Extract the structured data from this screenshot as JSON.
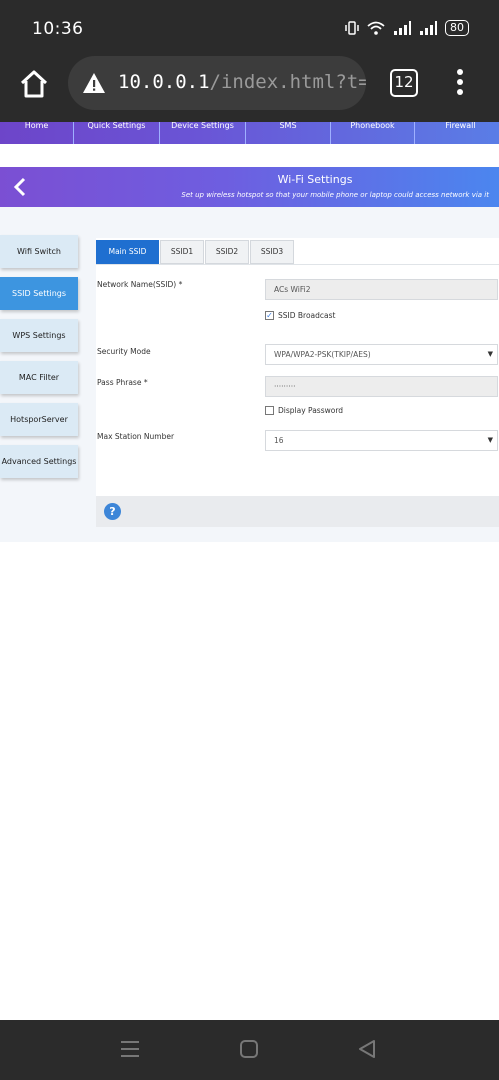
{
  "status": {
    "time": "10:36",
    "battery": "80"
  },
  "browser": {
    "url_host": "10.0.0.1",
    "url_path": "/index.html?t=#wifi",
    "tab_count": "12"
  },
  "top_nav": [
    {
      "label": "Home",
      "w": 66
    },
    {
      "label": "Quick Settings",
      "w": 86
    },
    {
      "label": "Device Settings",
      "w": 86
    },
    {
      "label": "SMS",
      "w": 85
    },
    {
      "label": "Phonebook",
      "w": 84
    },
    {
      "label": "Firewall",
      "w": 92
    }
  ],
  "header": {
    "title": "Wi-Fi Settings",
    "subtitle": "Set up wireless hotspot so that your mobile phone or laptop could access network via it"
  },
  "sidebar": {
    "items": [
      {
        "label": "Wifi Switch"
      },
      {
        "label": "SSID Settings"
      },
      {
        "label": "WPS Settings"
      },
      {
        "label": "MAC Filter"
      },
      {
        "label": "HotsporServer"
      },
      {
        "label": "Advanced Settings"
      }
    ],
    "active_index": 1
  },
  "tabs": [
    {
      "label": "Main SSID"
    },
    {
      "label": "SSID1"
    },
    {
      "label": "SSID2"
    },
    {
      "label": "SSID3"
    }
  ],
  "form": {
    "ssid_label": "Network Name(SSID) *",
    "ssid_value": "ACs WiFi2",
    "broadcast_label": "SSID Broadcast",
    "broadcast_checked": true,
    "security_label": "Security Mode",
    "security_value": "WPA/WPA2-PSK(TKIP/AES)",
    "pass_label": "Pass Phrase *",
    "pass_value": "·········",
    "display_password_label": "Display Password",
    "display_password_checked": false,
    "max_station_label": "Max Station Number",
    "max_station_value": "16"
  },
  "colors": {
    "accent_blue": "#1f6fd0",
    "sidebar_active": "#3d95e0",
    "banner_start": "#7b4fd3",
    "banner_end": "#4b86ef"
  }
}
